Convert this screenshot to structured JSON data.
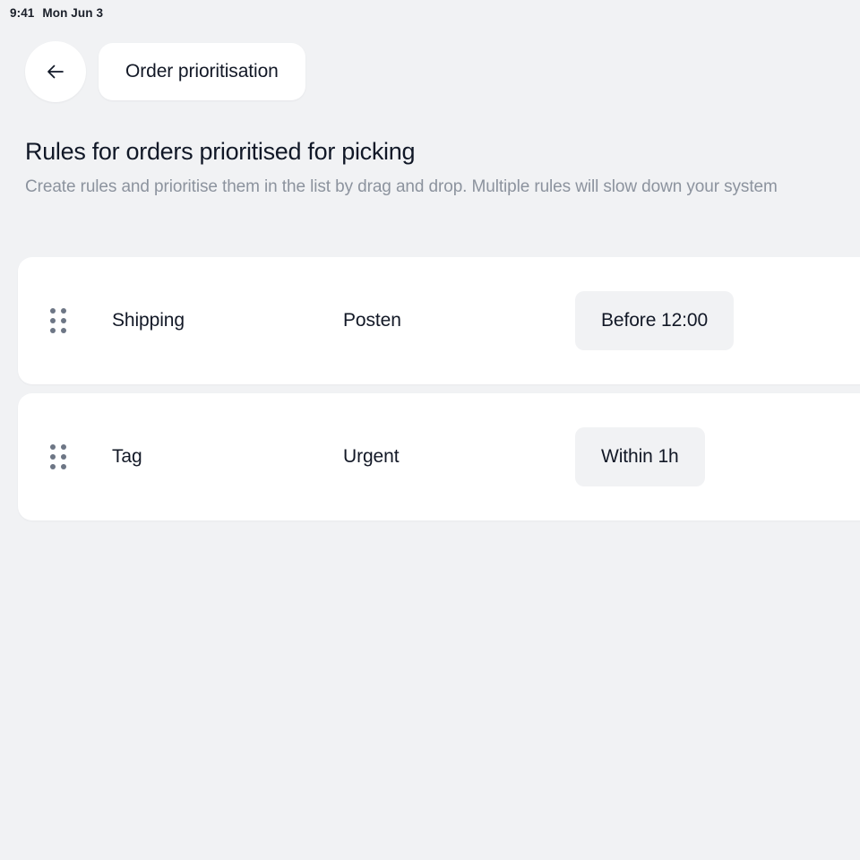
{
  "status_bar": {
    "time": "9:41",
    "date": "Mon Jun 3"
  },
  "top_nav": {
    "back_icon": "arrow-left-icon",
    "title": "Order prioritisation"
  },
  "header": {
    "title": "Rules for orders prioritised for picking",
    "subtitle": "Create rules and prioritise them in the list by drag and drop. Multiple rules will slow down your system"
  },
  "rules": [
    {
      "drag_handle_icon": "drag-handle-icon",
      "type": "Shipping",
      "value": "Posten",
      "chip": "Before 12:00"
    },
    {
      "drag_handle_icon": "drag-handle-icon",
      "type": "Tag",
      "value": "Urgent",
      "chip": "Within 1h"
    }
  ],
  "colors": {
    "page_background": "#f1f2f4",
    "card_background": "#ffffff",
    "text_primary": "#121826",
    "text_muted": "#8c939e",
    "chip_background": "#f1f2f4",
    "handle_dot": "#6d7685"
  }
}
